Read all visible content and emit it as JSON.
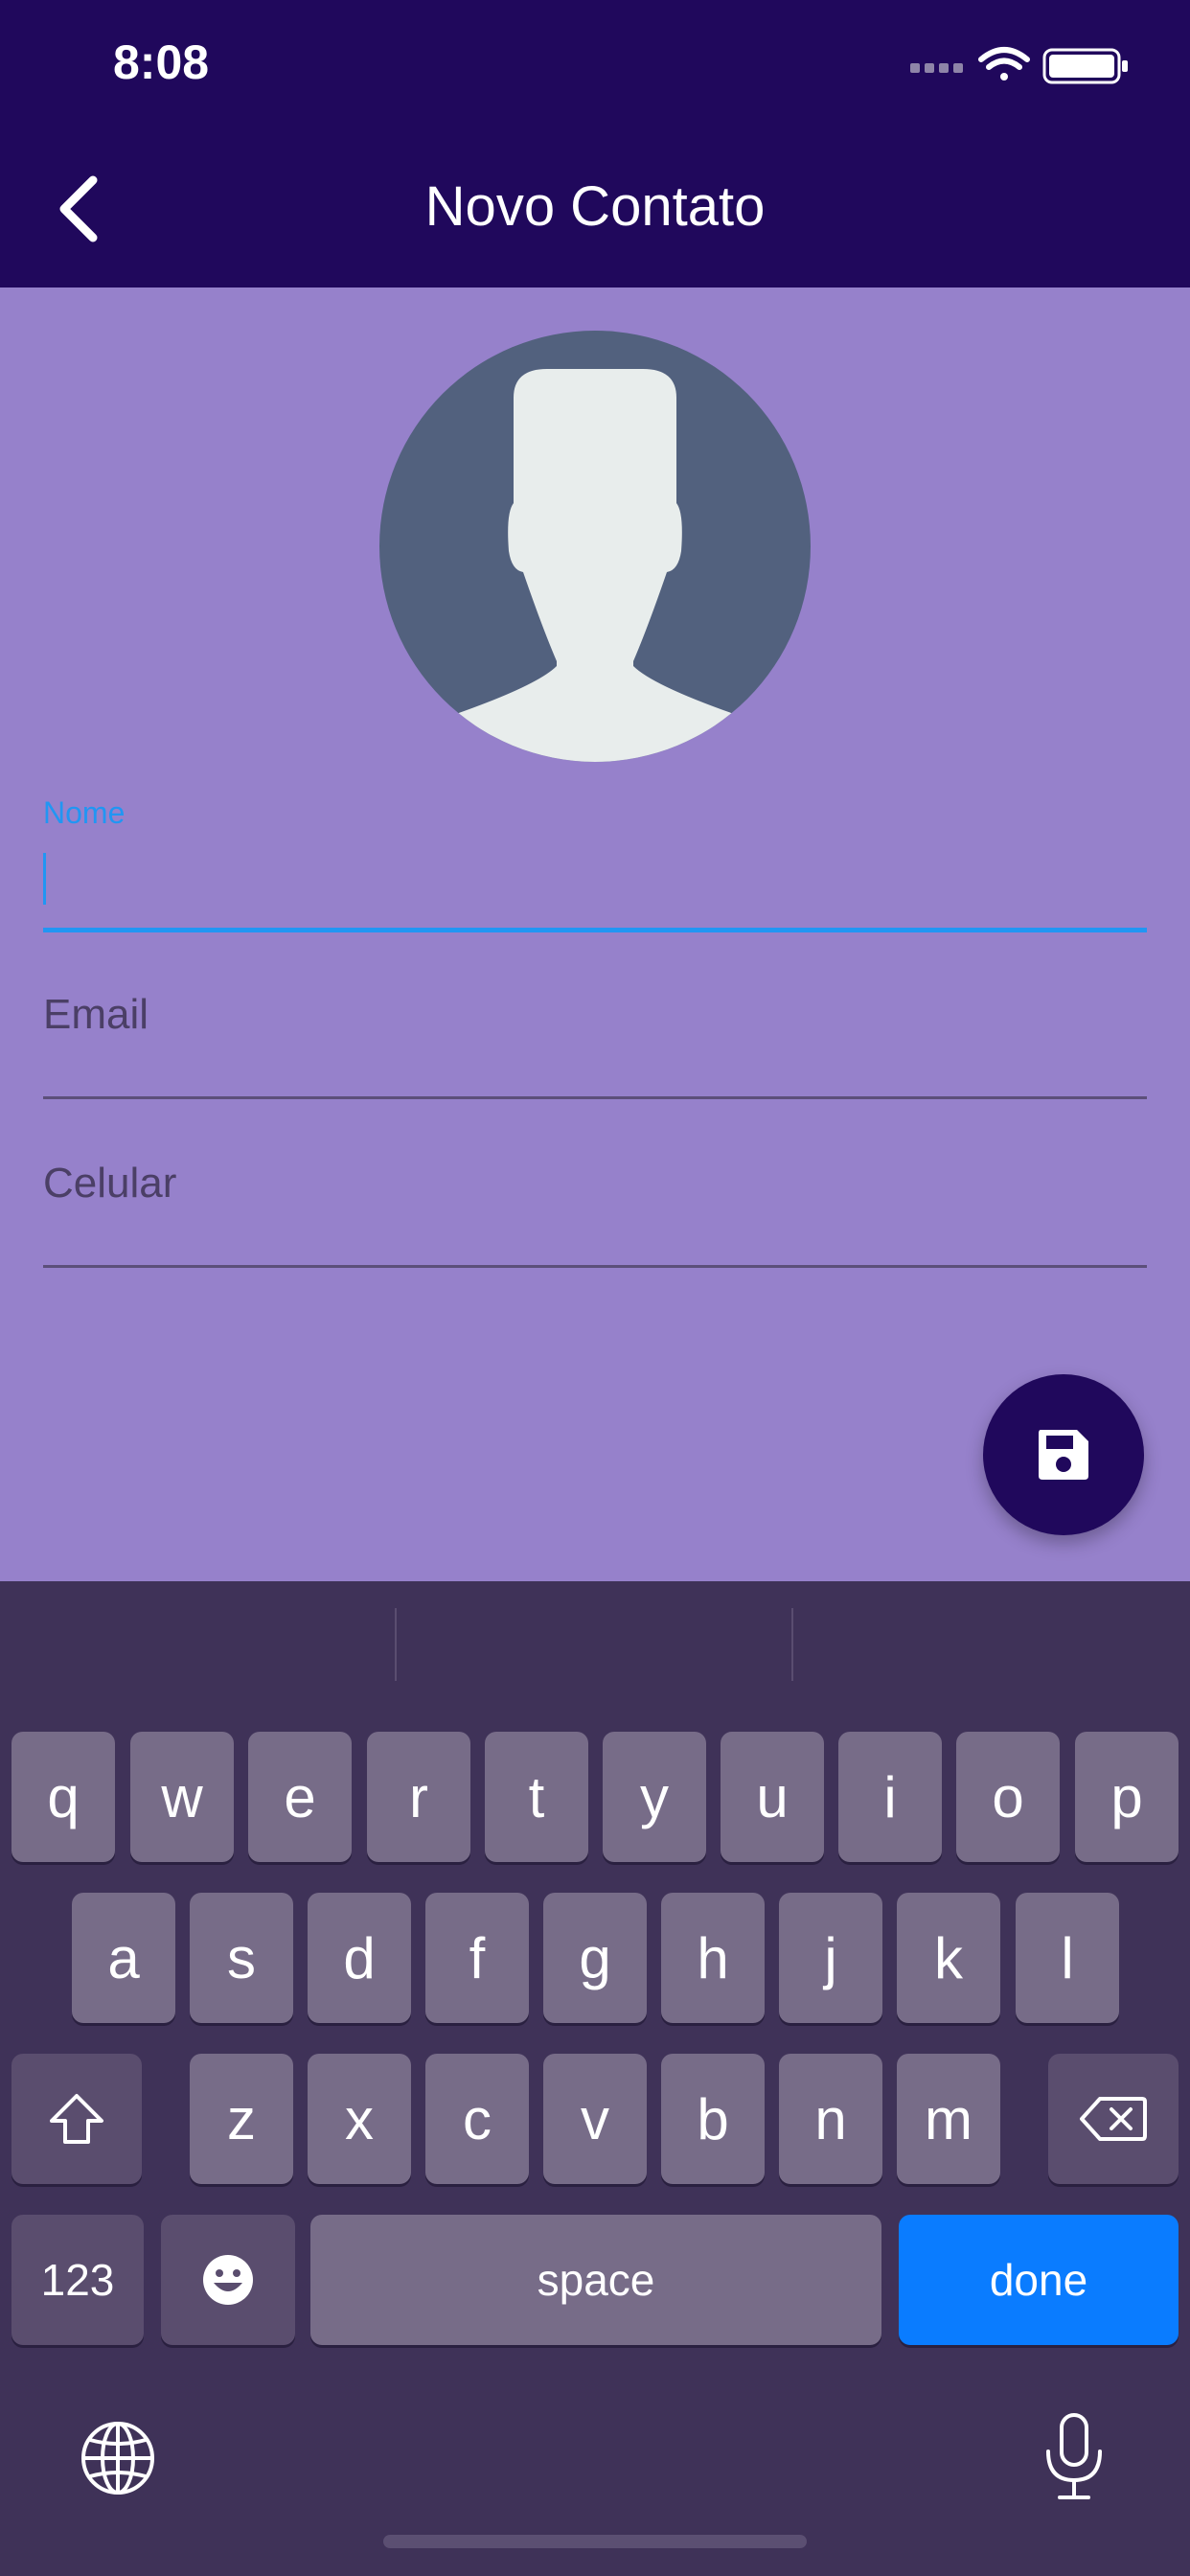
{
  "status_bar": {
    "time": "8:08"
  },
  "app_bar": {
    "title": "Novo Contato"
  },
  "form": {
    "nome": {
      "label": "Nome",
      "value": ""
    },
    "email": {
      "placeholder": "Email"
    },
    "celular": {
      "placeholder": "Celular"
    }
  },
  "keyboard": {
    "row1": [
      "q",
      "w",
      "e",
      "r",
      "t",
      "y",
      "u",
      "i",
      "o",
      "p"
    ],
    "row2": [
      "a",
      "s",
      "d",
      "f",
      "g",
      "h",
      "j",
      "k",
      "l"
    ],
    "row3": [
      "z",
      "x",
      "c",
      "v",
      "b",
      "n",
      "m"
    ],
    "numbers_label": "123",
    "space_label": "space",
    "done_label": "done"
  },
  "colors": {
    "app_bar": "#20085C",
    "background": "#9681CB",
    "accent": "#2196F3",
    "keyboard": "#3F3258",
    "done_key": "#0A7CFF"
  },
  "icons": {
    "back": "chevron-left-icon",
    "avatar": "person-silhouette-icon",
    "save": "floppy-disk-icon",
    "globe": "globe-icon",
    "mic": "microphone-icon",
    "shift": "shift-icon",
    "delete": "backspace-icon",
    "emoji": "emoji-icon"
  }
}
